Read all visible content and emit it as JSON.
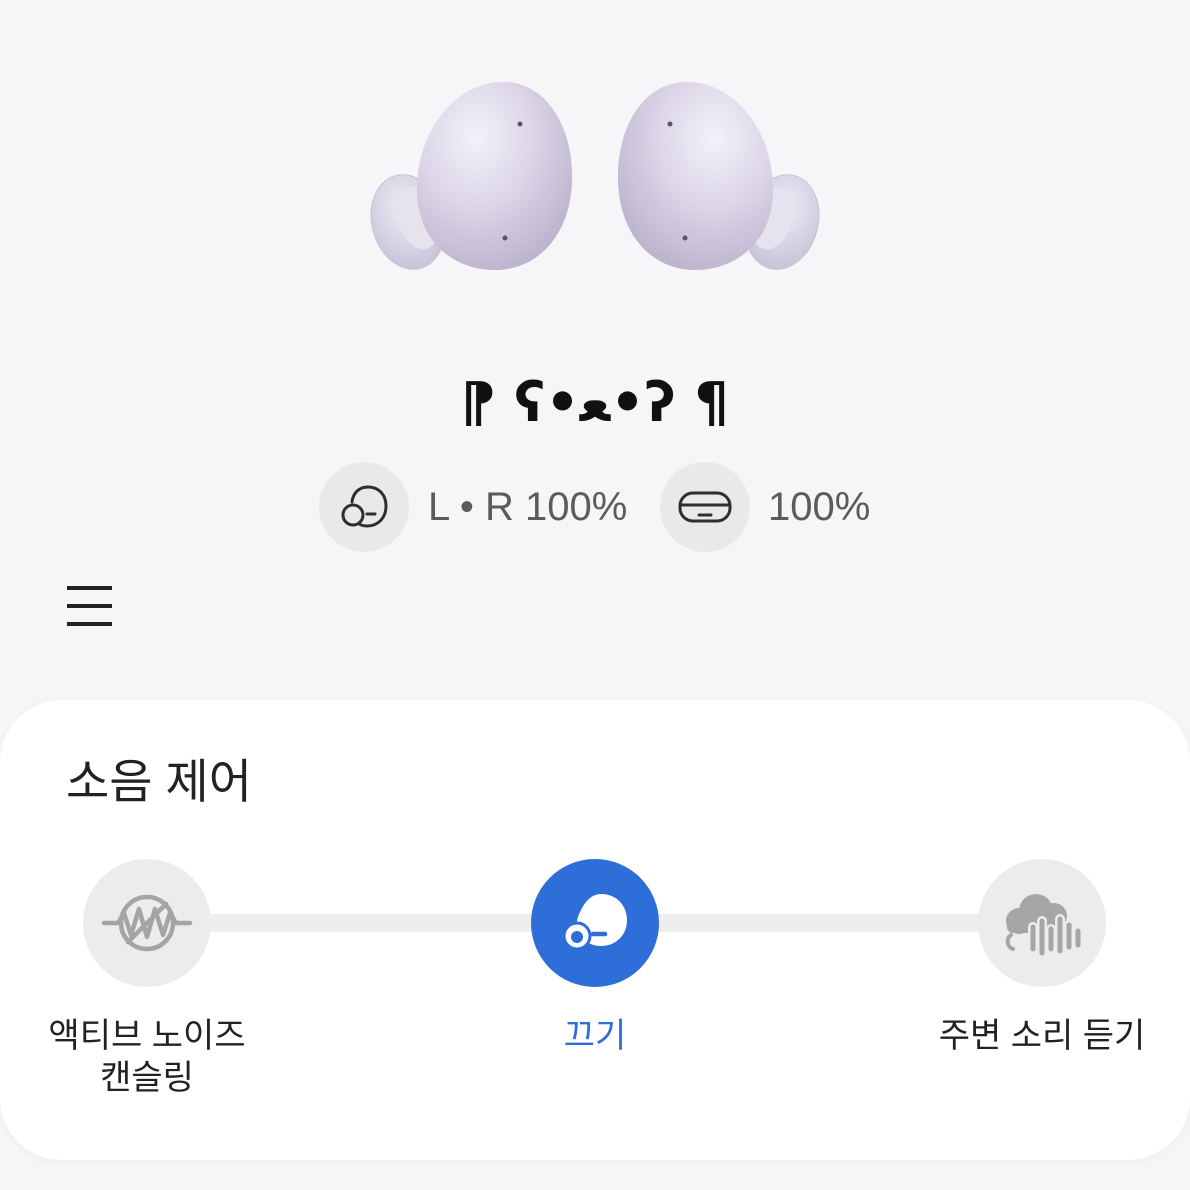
{
  "device": {
    "name": "⁋ ʕ•ﻌ•ʔ ¶"
  },
  "battery": {
    "buds": {
      "icon": "earbuds-icon",
      "label": "L • R 100%"
    },
    "case": {
      "icon": "charging-case-icon",
      "label": "100%"
    }
  },
  "menu": {
    "icon": "menu-icon"
  },
  "noise_control": {
    "title": "소음 제어",
    "options": [
      {
        "icon": "active-noise-canceling-icon",
        "label_lines": [
          "액티브 노이즈",
          "캔슬링"
        ],
        "selected": false
      },
      {
        "icon": "earbud-off-icon",
        "label_lines": [
          "끄기"
        ],
        "selected": true
      },
      {
        "icon": "ambient-sound-icon",
        "label_lines": [
          "주변 소리 듣기"
        ],
        "selected": false
      }
    ]
  },
  "colors": {
    "background": "#f6f6f8",
    "card": "#ffffff",
    "accent": "#2e6ed8",
    "earbud": "#d9d3e6"
  }
}
